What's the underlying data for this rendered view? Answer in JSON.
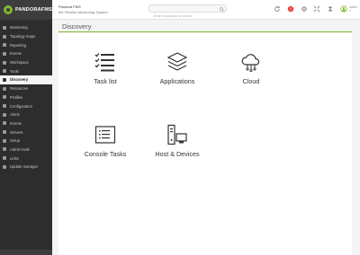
{
  "app": {
    "logo_text": "PANDORAFMS",
    "product_line1": "Pandora FMS",
    "product_line2": "the Flexible Monitoring System"
  },
  "search": {
    "placeholder": "Enter keywords to search"
  },
  "header": {
    "user_label": "admin ▾"
  },
  "sidebar": {
    "items": [
      {
        "label": "Monitoring",
        "active": false
      },
      {
        "label": "Topology maps",
        "active": false
      },
      {
        "label": "Reporting",
        "active": false
      },
      {
        "label": "Events",
        "active": false
      },
      {
        "label": "Workspace",
        "active": false
      },
      {
        "label": "Tools",
        "active": false
      },
      {
        "label": "Discovery",
        "active": true
      },
      {
        "label": "Resources",
        "active": false
      },
      {
        "label": "Profiles",
        "active": false
      },
      {
        "label": "Configuration",
        "active": false
      },
      {
        "label": "Alerts",
        "active": false
      },
      {
        "label": "Events",
        "active": false
      },
      {
        "label": "Servers",
        "active": false
      },
      {
        "label": "Setup",
        "active": false
      },
      {
        "label": "Admin tools",
        "active": false
      },
      {
        "label": "Links",
        "active": false
      },
      {
        "label": "Update manager",
        "active": false
      }
    ]
  },
  "main": {
    "title": "Discovery",
    "tiles": [
      {
        "label": "Task list",
        "icon": "task-list-icon"
      },
      {
        "label": "Applications",
        "icon": "layers-icon"
      },
      {
        "label": "Cloud",
        "icon": "cloud-icon"
      },
      {
        "label": "Console Tasks",
        "icon": "console-icon"
      },
      {
        "label": "Host & Devices",
        "icon": "host-devices-icon"
      }
    ]
  },
  "colors": {
    "accent": "#82b92e",
    "sidebar_bg": "#2d2d2d",
    "alert_red": "#e63c3c"
  }
}
